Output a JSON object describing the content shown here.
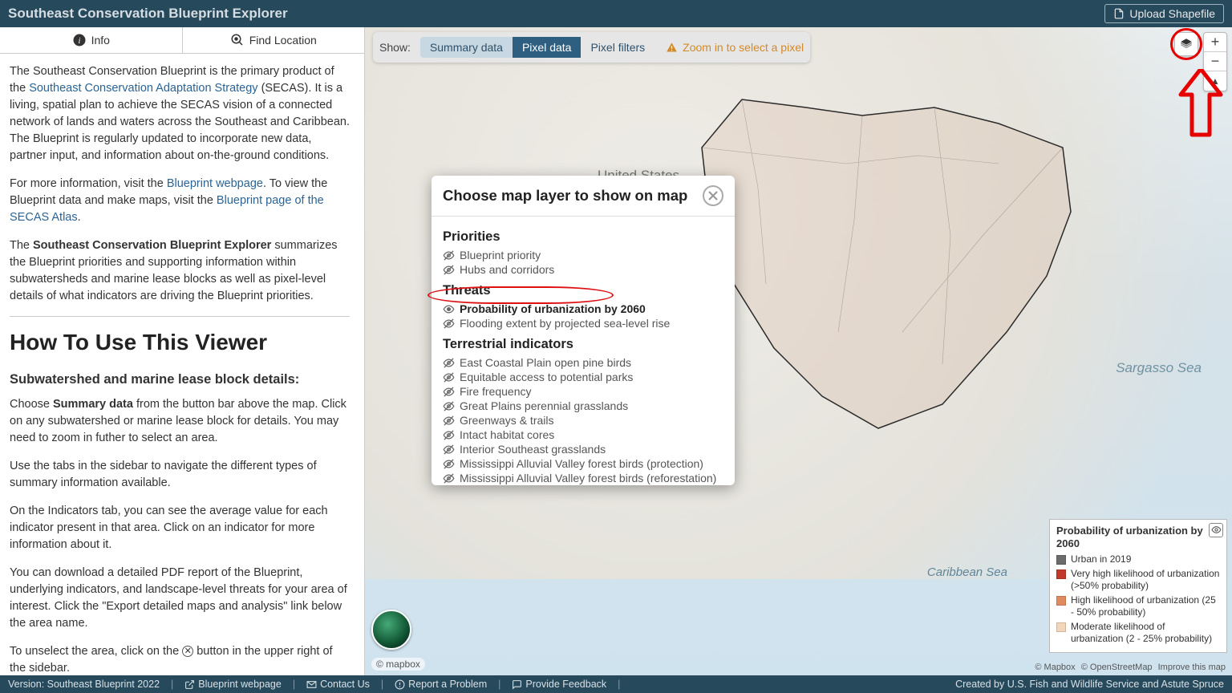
{
  "header": {
    "title": "Southeast Conservation Blueprint Explorer",
    "upload": "Upload Shapefile"
  },
  "sidebar": {
    "tabs": {
      "info": "Info",
      "find": "Find Location"
    },
    "intro_part1": "The Southeast Conservation Blueprint is the primary product of the ",
    "link_secas": "Southeast Conservation Adaptation Strategy",
    "intro_part2": " (SECAS). It is a living, spatial plan to achieve the SECAS vision of a connected network of lands and waters across the Southeast and Caribbean. The Blueprint is regularly updated to incorporate new data, partner input, and information about on-the-ground conditions.",
    "more_info_1": "For more information, visit the ",
    "link_bp_webpage": "Blueprint webpage",
    "more_info_2": ". To view the Blueprint data and make maps, visit the ",
    "link_bp_atlas": "Blueprint page of the SECAS Atlas",
    "period": ".",
    "summary_1": "The ",
    "summary_bold": "Southeast Conservation Blueprint Explorer",
    "summary_2": " summarizes the Blueprint priorities and supporting information within subwatersheds and marine lease blocks as well as pixel-level details of what indicators are driving the Blueprint priorities.",
    "howto_h1": "How To Use This Viewer",
    "sub_h3": "Subwatershed and marine lease block details:",
    "choose_1": "Choose ",
    "choose_bold": "Summary data",
    "choose_2": " from the button bar above the map. Click on any subwatershed or marine lease block for details. You may need to zoom in futher to select an area.",
    "use_tabs": "Use the tabs in the sidebar to navigate the different types of summary information available.",
    "indicators": "On the Indicators tab, you can see the average value for each indicator present in that area. Click on an indicator for more information about it.",
    "download": "You can download a detailed PDF report of the Blueprint, underlying indicators, and landscape-level threats for your area of interest. Click the \"Export detailed maps and analysis\" link below the area name.",
    "unselect_1": "To unselect the area, click on the ",
    "unselect_2": " button in the upper right of the sidebar."
  },
  "toolbar": {
    "show": "Show:",
    "summary": "Summary data",
    "pixel_data": "Pixel data",
    "pixel_filters": "Pixel filters",
    "zoom_hint": "Zoom in to select a pixel"
  },
  "map": {
    "us": "United States",
    "sargasso": "Sargasso Sea",
    "caribbean": "Caribbean Sea",
    "mapbox": "© mapbox",
    "attrib": {
      "mapbox": "© Mapbox",
      "osm": "© OpenStreetMap",
      "improve": "Improve this map"
    }
  },
  "modal": {
    "title": "Choose map layer to show on map",
    "groups": [
      {
        "title": "Priorities",
        "items": [
          "Blueprint priority",
          "Hubs and corridors"
        ]
      },
      {
        "title": "Threats",
        "items": [
          "Probability of urbanization by 2060",
          "Flooding extent by projected sea-level rise"
        ],
        "active": 0
      },
      {
        "title": "Terrestrial indicators",
        "items": [
          "East Coastal Plain open pine birds",
          "Equitable access to potential parks",
          "Fire frequency",
          "Great Plains perennial grasslands",
          "Greenways & trails",
          "Intact habitat cores",
          "Interior Southeast grasslands",
          "Mississippi Alluvial Valley forest birds (protection)",
          "Mississippi Alluvial Valley forest birds (reforestation)"
        ]
      }
    ]
  },
  "legend": {
    "title": "Probability of urbanization by 2060",
    "rows": [
      {
        "color": "#6b6b6b",
        "label": "Urban in 2019"
      },
      {
        "color": "#c0392b",
        "label": "Very high likelihood of urbanization (>50% probability)"
      },
      {
        "color": "#e08b5f",
        "label": "High likelihood of urbanization (25 - 50% probability)"
      },
      {
        "color": "#f3d6ba",
        "label": "Moderate likelihood of urbanization (2 - 25% probability)"
      }
    ]
  },
  "footer": {
    "version": "Version: Southeast Blueprint 2022",
    "links": [
      "Blueprint webpage",
      "Contact Us",
      "Report a Problem",
      "Provide Feedback"
    ],
    "credit": "Created by U.S. Fish and Wildlife Service and Astute Spruce"
  }
}
